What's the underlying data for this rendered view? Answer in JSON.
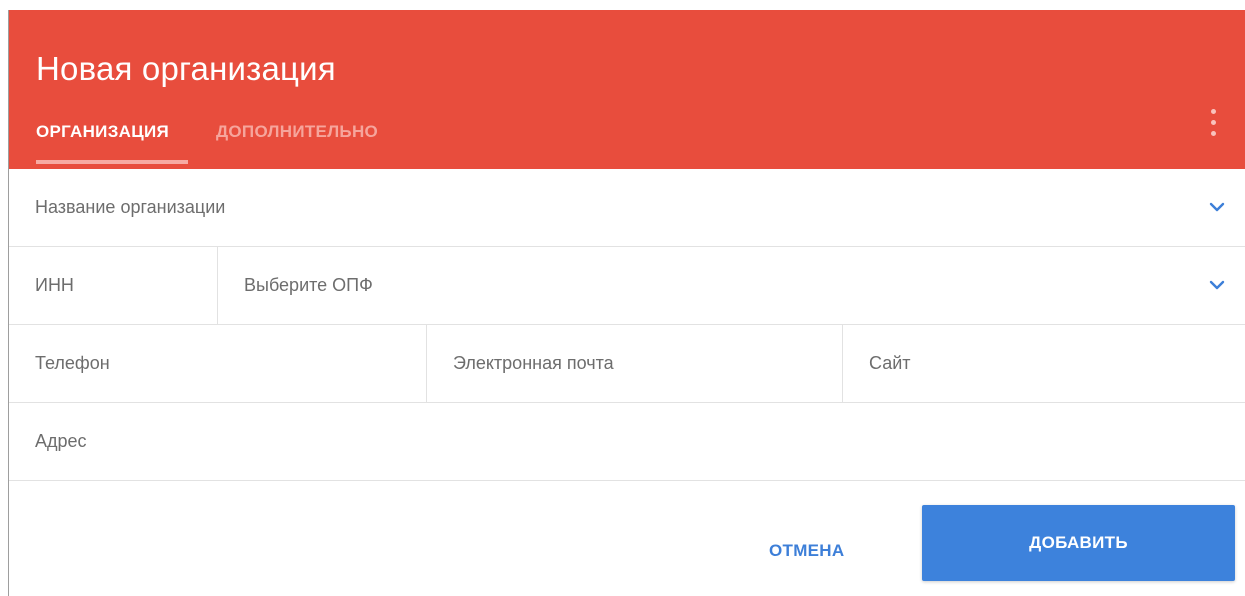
{
  "dialog": {
    "title": "Новая организация",
    "tabs": [
      {
        "label": "ОРГАНИЗАЦИЯ",
        "active": true
      },
      {
        "label": "ДОПОЛНИТЕЛЬНО",
        "active": false
      }
    ],
    "menu_icon": "more-vertical-icon"
  },
  "form": {
    "org_name_placeholder": "Название организации",
    "inn_placeholder": "ИНН",
    "opf_placeholder": "Выберите ОПФ",
    "phone_placeholder": "Телефон",
    "email_placeholder": "Электронная почта",
    "site_placeholder": "Сайт",
    "address_placeholder": "Адрес"
  },
  "actions": {
    "cancel_label": "ОТМЕНА",
    "add_label": "ДОБАВИТЬ"
  },
  "colors": {
    "header": "#e84d3d",
    "accent": "#3d82dc",
    "tab_inactive": "#f6a59c",
    "placeholder": "#6d6d6d"
  }
}
